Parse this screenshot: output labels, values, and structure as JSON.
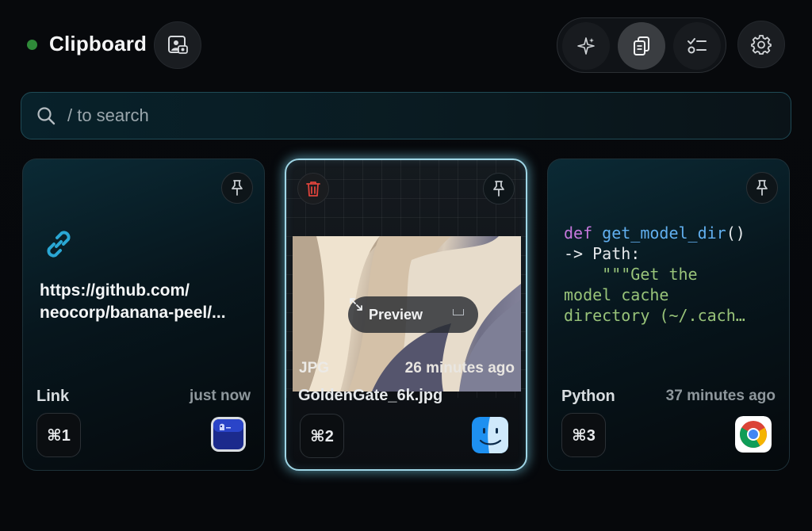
{
  "header": {
    "title": "Clipboard",
    "status_color": "#2f8a39",
    "buttons": {
      "screenshot": "screenshot-icon",
      "ai": "sparkles-icon",
      "clipboard": "clipboard-icon",
      "checklist": "checklist-icon",
      "settings": "gear-icon"
    },
    "selected_mode": "clipboard"
  },
  "search": {
    "placeholder": "/ to search",
    "value": ""
  },
  "cards": [
    {
      "kind": "link",
      "url_line1": "https://github.com/",
      "url_line2": "neocorp/banana-peel/...",
      "type_label": "Link",
      "time": "just now",
      "shortcut": "⌘1",
      "source_app": "terminal-app-icon",
      "pinned": false
    },
    {
      "kind": "image",
      "selected": true,
      "preview_label": "Preview",
      "image_type": "JPG",
      "image_time": "26 minutes ago",
      "file_name": "GoldenGate_6k.jpg",
      "shortcut": "⌘2",
      "source_app": "finder-app-icon",
      "pinned": false
    },
    {
      "kind": "code",
      "code": {
        "kw": "def",
        "fn": "get_model_dir",
        "paren": "()",
        "line2": "-> Path:",
        "line3": "    \"\"\"Get the",
        "line4": "model cache",
        "line5": "directory (~/.cach…"
      },
      "type_label": "Python",
      "time": "37 minutes ago",
      "shortcut": "⌘3",
      "source_app": "chrome-app-icon",
      "pinned": false
    }
  ]
}
